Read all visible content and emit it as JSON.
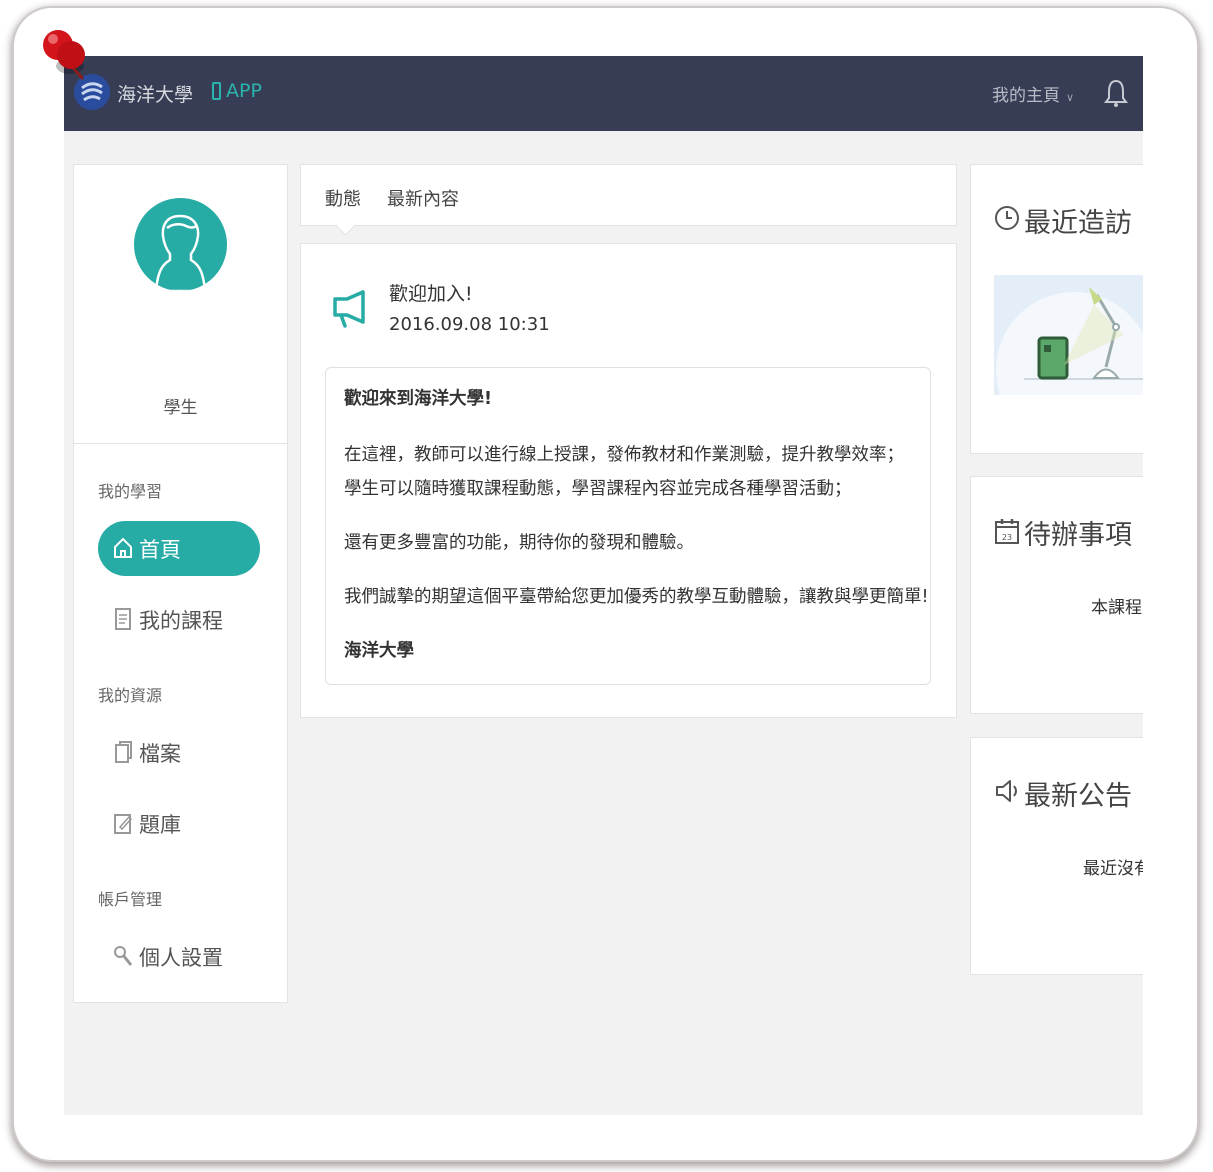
{
  "header": {
    "brand": "海洋大學",
    "app_label": "APP",
    "my_home": "我的主頁"
  },
  "profile": {
    "role": "學生"
  },
  "sidebar": {
    "sections": [
      {
        "title": "我的學習",
        "items": [
          {
            "label": "首頁",
            "icon": "home-icon",
            "active": true
          },
          {
            "label": "我的課程",
            "icon": "document-icon"
          }
        ]
      },
      {
        "title": "我的資源",
        "items": [
          {
            "label": "檔案",
            "icon": "file-icon"
          },
          {
            "label": "題庫",
            "icon": "edit-icon"
          }
        ]
      },
      {
        "title": "帳戶管理",
        "items": [
          {
            "label": "個人設置",
            "icon": "wrench-icon"
          }
        ]
      }
    ]
  },
  "main": {
    "tabs": [
      {
        "label": "動態"
      },
      {
        "label": "最新內容"
      }
    ],
    "post": {
      "title": "歡迎加入!",
      "time": "2016.09.08 10:31",
      "heading": "歡迎來到海洋大學!",
      "line1": "在這裡，教師可以進行線上授課，發佈教材和作業測驗，提升教學效率；",
      "line2": "學生可以隨時獲取課程動態，學習課程內容並完成各種學習活動；",
      "line3": "還有更多豐富的功能，期待你的發現和體驗。",
      "line4": "我們誠摯的期望這個平臺帶給您更加優秀的教學互動體驗，讓教與學更簡單!",
      "signature": "海洋大學"
    }
  },
  "right": {
    "recent": {
      "title": "最近造訪"
    },
    "todo": {
      "title": "待辦事項",
      "text": "本課程",
      "calendar_day": "23"
    },
    "announcements": {
      "title": "最新公告",
      "text": "最近沒有"
    }
  },
  "colors": {
    "topbar": "#363d55",
    "accent": "#26aba5",
    "page_bg": "#f2f2f2"
  }
}
